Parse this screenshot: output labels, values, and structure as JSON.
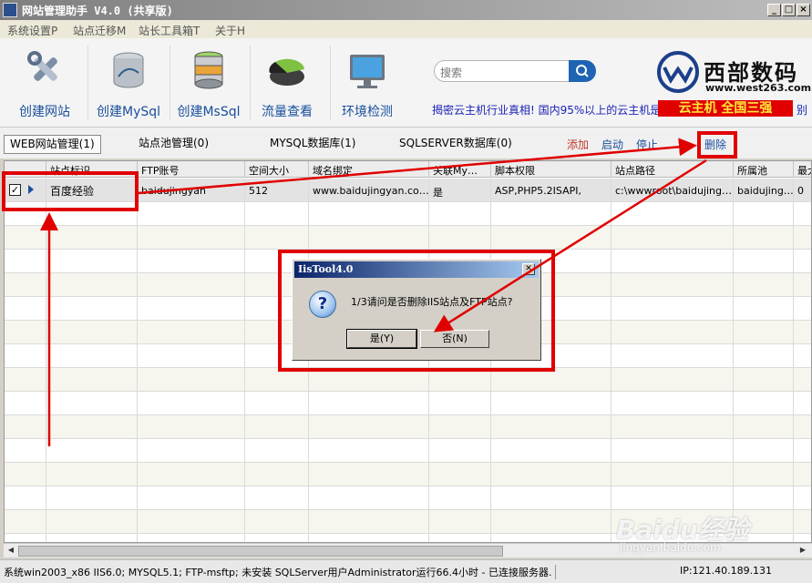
{
  "window": {
    "title": "网站管理助手 V4.0 (共享版)",
    "minimize": "_",
    "maximize": "□",
    "close": "×"
  },
  "menu": [
    "系统设置P",
    "站点迁移M",
    "站长工具箱T",
    "关于H"
  ],
  "toolbar": {
    "buttons": [
      {
        "label": "创建网站",
        "icon": "tools-icon"
      },
      {
        "label": "创建MySql",
        "icon": "mysql-database-icon"
      },
      {
        "label": "创建MsSql",
        "icon": "mssql-database-icon"
      },
      {
        "label": "流量查看",
        "icon": "pie-chart-icon"
      },
      {
        "label": "环境检测",
        "icon": "monitor-icon"
      }
    ],
    "search_placeholder": "搜索",
    "marquee": "揭密云主机行业真相! 国内95%以上的云主机是",
    "brand_name": "西部数码",
    "brand_url": "www.west263.com",
    "promo": "云主机 全国三强",
    "promo_tail": "别"
  },
  "tabs": [
    "WEB网站管理(1)",
    "站点池管理(0)",
    "MYSQL数据库(1)",
    "SQLSERVER数据库(0)"
  ],
  "actions": [
    {
      "label": "添加",
      "color": "#c0392b"
    },
    {
      "label": "启动",
      "color": "#1a4f9c"
    },
    {
      "label": "停止",
      "color": "#1a4f9c"
    },
    {
      "label": "删除",
      "color": "#1a4f9c"
    }
  ],
  "grid": {
    "columns": [
      "站点标识",
      "FTP账号",
      "空间大小",
      "域名绑定",
      "关联My…",
      "脚本权限",
      "站点路径",
      "所属池",
      "最大"
    ],
    "rows": [
      {
        "checked": true,
        "site": "百度经验",
        "ftp": "baidujingyan",
        "size": "512",
        "domain": "www.baidujingyan.co…",
        "mysql": "是",
        "script": "ASP,PHP5.2ISAPI,",
        "path": "c:\\wwwroot\\baidujing…",
        "pool": "baidujing…",
        "max": "0"
      }
    ]
  },
  "dialog": {
    "title": "IisTool4.0",
    "message": "1/3请问是否删除IIS站点及FTP站点?",
    "yes": "是(Y)",
    "no": "否(N)",
    "icon": "question-icon"
  },
  "status": {
    "text": "系统win2003_x86 IIS6.0; MYSQL5.1; FTP-msftp; 未安装 SQLServer用户Administrator运行66.4小时 - 已连接服务器.",
    "ip": "IP:121.40.189.131"
  },
  "watermark": {
    "main": "Baidu经验",
    "sub": "jingyan.baidu.com"
  }
}
